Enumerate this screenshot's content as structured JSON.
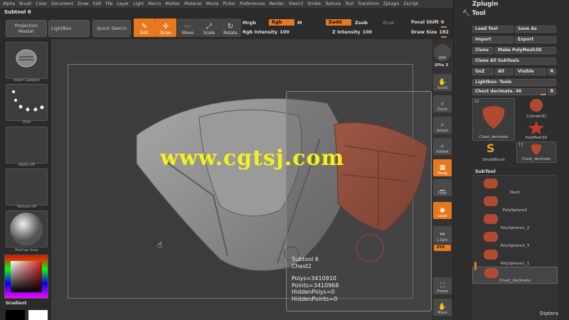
{
  "menu": [
    "Alpha",
    "Brush",
    "Color",
    "Document",
    "Draw",
    "Edit",
    "File",
    "Layer",
    "Light",
    "Macro",
    "Marker",
    "Material",
    "Movie",
    "Picker",
    "Preferences",
    "Render",
    "Stencil",
    "Stroke",
    "Texture",
    "Tool",
    "Transform",
    "Zplugin",
    "Zscript"
  ],
  "subtool_title": "Subtool 6",
  "top_buttons": {
    "projection_master": "Projection Master",
    "lightbox": "LightBox",
    "quick_sketch": "Quick Sketch",
    "edit": "Edit",
    "draw": "Draw",
    "move": "Move",
    "scale": "Scale",
    "rotate": "Rotate"
  },
  "params": {
    "mrgb": "Mrgb",
    "rgb": "Rgb",
    "m": "M",
    "zadd": "Zadd",
    "zsub": "Zsub",
    "zcut": "Zcut",
    "rgb_intensity_label": "Rgb Intensity",
    "rgb_intensity": "100",
    "z_intensity_label": "Z Intensity",
    "z_intensity": "100",
    "focal_shift_label": "Focal Shift",
    "focal_shift": "0",
    "draw_size_label": "Draw Size",
    "draw_size": "182"
  },
  "left_shelf": {
    "brush_label": "Insert Gadgets",
    "stroke_label": "Dots",
    "alpha_label": "Alpha Off",
    "texture_label": "Texture Off",
    "material_label": "MatCap Gray",
    "gradient_label": "Gradient"
  },
  "right_strip": {
    "bpr": "BPR",
    "spix_label": "SPix",
    "spix": "3",
    "scroll": "Scroll",
    "zoom": "Zoom",
    "actual": "Actual",
    "aahalf": "AAHalf",
    "persp": "Persp",
    "floor": "Floor",
    "local": "Local",
    "lsym": "L.Sym",
    "xyz": "XYZ",
    "frame": "Frame",
    "move": "Move"
  },
  "right_panel": {
    "zplugin": "Zplugin",
    "tool": "Tool",
    "load_tool": "Load Tool",
    "save_as": "Save As",
    "import": "Import",
    "export": "Export",
    "clone": "Clone",
    "make_polymesh": "Make PolyMesh3D",
    "clone_all": "Clone All SubTools",
    "goz": "GoZ",
    "all": "All",
    "visible": "Visible",
    "r": "R",
    "lightbox_tools": "Lightbox› Tools",
    "chest_decimate_label": "Chest decimate.",
    "chest_decimate_value": "48",
    "tool_count_1": "13",
    "tool_count_2": "13",
    "tool_chest": "Chest_decimate",
    "tool_cylinder": "Cylinder3D",
    "tool_polymesh": "PolyMesh3D",
    "tool_simplebrush": "SimpleBrush",
    "tool_chest2": "Chest_decimate",
    "subtool_header": "SubTool"
  },
  "subtools": [
    "Neck",
    "PolySphere2",
    "PolySphere1_2",
    "PolySphere1_3",
    "PolySphere1_1",
    "Chest_decimate"
  ],
  "info": {
    "line1": "Subtool 6",
    "line2": "Chest2",
    "polys": "Polys=3410910",
    "points": "Points=3410968",
    "hidden_polys": "HiddenPolys=0",
    "hidden_points": "HiddenPoints=0"
  },
  "watermark": "www.cgtsj.com",
  "corner_text": "Diptera",
  "colors": {
    "accent": "#e8781e",
    "watermark": "#f6f11a",
    "model_gray": "#8e8e8e",
    "model_red": "#b24a32"
  }
}
